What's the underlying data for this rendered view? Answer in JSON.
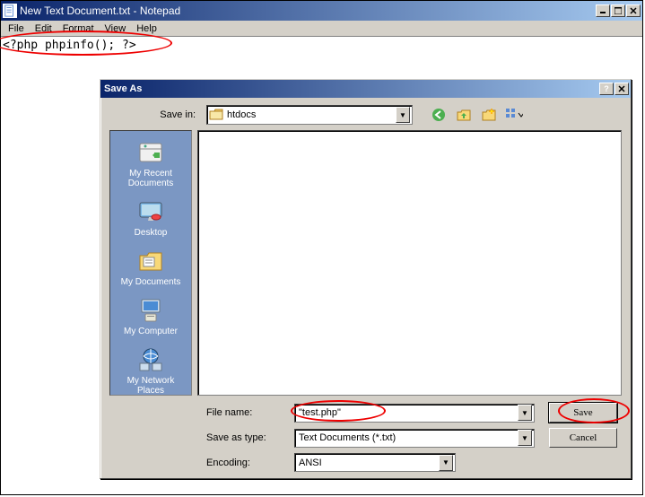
{
  "notepad": {
    "title": "New Text Document.txt - Notepad",
    "menu": {
      "file": "File",
      "edit": "Edit",
      "format": "Format",
      "view": "View",
      "help": "Help"
    },
    "content": "<?php phpinfo(); ?>"
  },
  "saveas": {
    "title": "Save As",
    "savein_label": "Save in:",
    "savein_value": "htdocs",
    "places": {
      "recent": "My Recent\nDocuments",
      "desktop": "Desktop",
      "mydocs": "My Documents",
      "mycomp": "My Computer",
      "network": "My Network\nPlaces"
    },
    "filename_label": "File name:",
    "filename_value": "\"test.php\"",
    "savetype_label": "Save as type:",
    "savetype_value": "Text Documents (*.txt)",
    "encoding_label": "Encoding:",
    "encoding_value": "ANSI",
    "save_btn": "Save",
    "cancel_btn": "Cancel"
  }
}
